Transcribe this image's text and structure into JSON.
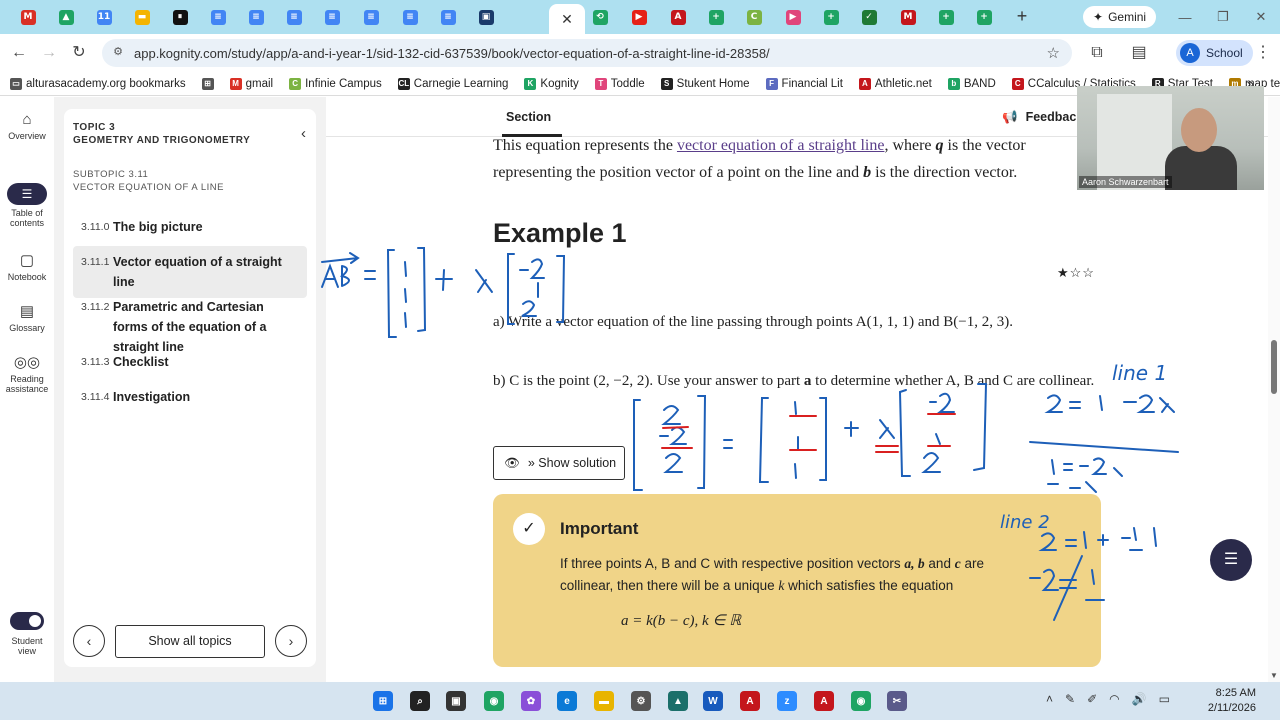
{
  "browser": {
    "active_tab_close": "✕",
    "new_tab": "+",
    "gemini_label": "Gemini",
    "url": "app.kognity.com/study/app/a-and-i-year-1/sid-132-cid-637539/book/vector-equation-of-a-straight-line-id-28358/",
    "profile_label": "School",
    "profile_initial": "A",
    "tab_icons": [
      {
        "letter": "M",
        "color": "#d93025"
      },
      {
        "letter": "▲",
        "color": "#1fa463"
      },
      {
        "letter": "11",
        "color": "#4285f4"
      },
      {
        "letter": "▬",
        "color": "#f4b400"
      },
      {
        "letter": "⏸",
        "color": "#111111"
      },
      {
        "letter": "≡",
        "color": "#4285f4"
      },
      {
        "letter": "≡",
        "color": "#4285f4"
      },
      {
        "letter": "≡",
        "color": "#4285f4"
      },
      {
        "letter": "≡",
        "color": "#4285f4"
      },
      {
        "letter": "≡",
        "color": "#4285f4"
      },
      {
        "letter": "≡",
        "color": "#4285f4"
      },
      {
        "letter": "≡",
        "color": "#4285f4"
      },
      {
        "letter": "▣",
        "color": "#1a3a6a"
      }
    ],
    "tab_icons_right": [
      {
        "letter": "⟲",
        "color": "#1fa463"
      },
      {
        "letter": "▶",
        "color": "#e62117"
      },
      {
        "letter": "A",
        "color": "#c4161c"
      },
      {
        "letter": "+",
        "color": "#1fa463"
      },
      {
        "letter": "C",
        "color": "#7cb342"
      },
      {
        "letter": "▶",
        "color": "#e0457b"
      },
      {
        "letter": "+",
        "color": "#1fa463"
      },
      {
        "letter": "✓",
        "color": "#1f7a35"
      },
      {
        "letter": "M",
        "color": "#c4161c"
      },
      {
        "letter": "+",
        "color": "#1fa463"
      },
      {
        "letter": "+",
        "color": "#1fa463"
      }
    ]
  },
  "bookmarks": [
    {
      "label": "alturasacademy.org bookmarks",
      "icon": "folder-icon",
      "color": "#555555",
      "glyph": "▭"
    },
    {
      "label": "",
      "icon": "apps-grid-icon",
      "color": "#555555",
      "glyph": "⊞"
    },
    {
      "label": "gmail",
      "icon": "gmail-icon",
      "color": "#d93025",
      "glyph": "M"
    },
    {
      "label": "Infinie Campus",
      "icon": "campus-icon",
      "color": "#7cb342",
      "glyph": "C"
    },
    {
      "label": "Carnegie Learning",
      "icon": "carnegie-icon",
      "color": "#222222",
      "glyph": "CL"
    },
    {
      "label": "Kognity",
      "icon": "kognity-icon",
      "color": "#1fa463",
      "glyph": "K"
    },
    {
      "label": "Toddle",
      "icon": "toddle-icon",
      "color": "#e0457b",
      "glyph": "T"
    },
    {
      "label": "Stukent Home",
      "icon": "stukent-icon",
      "color": "#222222",
      "glyph": "S"
    },
    {
      "label": "Financial Lit",
      "icon": "finlit-icon",
      "color": "#5c6bc0",
      "glyph": "F"
    },
    {
      "label": "Athletic.net",
      "icon": "athletic-icon",
      "color": "#c4161c",
      "glyph": "A"
    },
    {
      "label": "BAND",
      "icon": "band-icon",
      "color": "#1fa463",
      "glyph": "b"
    },
    {
      "label": "CCalculus / Statistics",
      "icon": "classroom-icon",
      "color": "#c4161c",
      "glyph": "C"
    },
    {
      "label": "Star Test",
      "icon": "star-test-icon",
      "color": "#222222",
      "glyph": "R"
    },
    {
      "label": "map test",
      "icon": "map-test-icon",
      "color": "#b07a00",
      "glyph": "m"
    }
  ],
  "bookmarks_more": "»",
  "rail": [
    {
      "label": "Overview",
      "icon": "home-icon",
      "glyph": "⌂"
    },
    {
      "label": "Table of contents",
      "icon": "table-of-contents-icon",
      "glyph": "☰"
    },
    {
      "label": "Notebook",
      "icon": "notebook-icon",
      "glyph": "▢"
    },
    {
      "label": "Glossary",
      "icon": "glossary-icon",
      "glyph": "▤"
    },
    {
      "label": "Reading assistance",
      "icon": "reading-glasses-icon",
      "glyph": "◎◎"
    }
  ],
  "student_view_label": "Student view",
  "toc": {
    "topic_label": "TOPIC 3",
    "topic_name": "GEOMETRY AND TRIGONOMETRY",
    "subtopic_label": "SUBTOPIC 3.11",
    "subtopic_name": "VECTOR EQUATION OF A LINE",
    "collapse_glyph": "‹",
    "items": [
      {
        "num": "3.11.0",
        "label": "The big picture"
      },
      {
        "num": "3.11.1",
        "label": "Vector equation of a straight line"
      },
      {
        "num": "3.11.2",
        "label": "Parametric and Cartesian forms of the equation of a straight line"
      },
      {
        "num": "3.11.3",
        "label": "Checklist"
      },
      {
        "num": "3.11.4",
        "label": "Investigation"
      }
    ],
    "prev_glyph": "‹",
    "next_glyph": "›",
    "show_all": "Show all topics"
  },
  "main": {
    "section_tab": "Section",
    "feedback": "Feedback",
    "intro_1": "This equation represents the ",
    "intro_link": "vector equation of a straight line",
    "intro_2": ", where ",
    "intro_q": "q",
    "intro_3": " is the vector representing the position vector of a point on the line and ",
    "intro_b": "b",
    "intro_4": " is the direction vector.",
    "example_title": "Example 1",
    "stars": "★☆☆",
    "qa": "a) Write a vector equation of the line passing through points A(1, 1, 1) and B(−1, 2, 3).",
    "qb_1": "b) C is the point (2, −2, 2). Use your answer to part ",
    "qb_a": "a",
    "qb_2": " to determine whether A, B and C are collinear.",
    "show_solution": "» Show solution",
    "important_title": "Important",
    "important_body_1": "If three points A, B and C with respective position vectors ",
    "important_vars": "a, b",
    "important_and": " and ",
    "important_c": "c",
    "important_body_2": " are collinear, then there will be a unique ",
    "important_k": "k",
    "important_body_3": " which satisfies the equation",
    "important_eq": "a = k(b − c),  k ∈ ℝ"
  },
  "video": {
    "name": "Aaron Schwarzenbart"
  },
  "ink": {
    "color": "#1d5fb8",
    "accent": "#d92020",
    "left_eq": "AB⃗ = [1 1 1] + λ[−2 1 2]",
    "line1_label": "line 1",
    "line2_label": "line 2"
  },
  "clock": {
    "time": "8:25 AM",
    "date": "2/11/2026"
  },
  "taskbar_icons": [
    {
      "name": "windows-start-icon",
      "glyph": "⊞",
      "color": "#1a73e8"
    },
    {
      "name": "search-icon",
      "glyph": "⌕",
      "color": "#222222"
    },
    {
      "name": "task-view-icon",
      "glyph": "▣",
      "color": "#333333"
    },
    {
      "name": "chrome-icon",
      "glyph": "◉",
      "color": "#1fa463"
    },
    {
      "name": "copilot-icon",
      "glyph": "✿",
      "color": "#8a4fd8"
    },
    {
      "name": "edge-icon",
      "glyph": "e",
      "color": "#0c7ad6"
    },
    {
      "name": "file-explorer-icon",
      "glyph": "▬",
      "color": "#e8b400"
    },
    {
      "name": "settings-icon",
      "glyph": "⚙",
      "color": "#555555"
    },
    {
      "name": "photos-icon",
      "glyph": "▲",
      "color": "#1b6f6a"
    },
    {
      "name": "word-icon",
      "glyph": "W",
      "color": "#185abd"
    },
    {
      "name": "acrobat-icon",
      "glyph": "A",
      "color": "#c4161c"
    },
    {
      "name": "zoom-icon",
      "glyph": "z",
      "color": "#2d8cff"
    },
    {
      "name": "pdf-reader-icon",
      "glyph": "A",
      "color": "#c4161c"
    },
    {
      "name": "chrome-profile-icon",
      "glyph": "◉",
      "color": "#1fa463"
    },
    {
      "name": "snipping-icon",
      "glyph": "✂",
      "color": "#5a5a8a"
    }
  ],
  "tray": [
    "˄",
    "✎",
    "✐",
    "◠",
    "🔊",
    "▭"
  ]
}
